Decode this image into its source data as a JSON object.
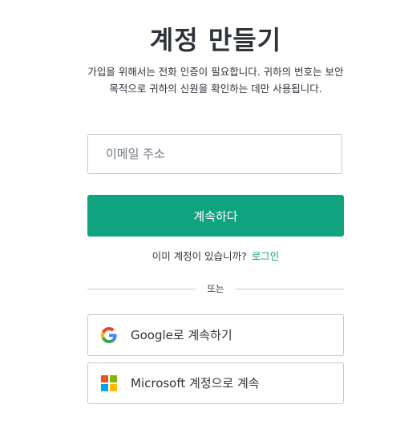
{
  "header": {
    "title": "계정 만들기",
    "subtitle": "가입을 위해서는 전화 인증이 필요합니다. 귀하의 번호는 보안 목적으로 귀하의 신원을 확인하는 데만 사용됩니다."
  },
  "form": {
    "email_placeholder": "이메일 주소",
    "email_value": "",
    "continue_label": "계속하다"
  },
  "login": {
    "prompt": "이미 계정이 있습니까?",
    "link_label": "로그인"
  },
  "divider": {
    "label": "또는"
  },
  "social": {
    "google_label": "Google로 계속하기",
    "google_icon": "google-icon",
    "microsoft_label": "Microsoft 계정으로 계속",
    "microsoft_icon": "microsoft-icon"
  },
  "colors": {
    "accent": "#10a37f",
    "border": "#c2c8d0",
    "text": "#2d333a"
  }
}
